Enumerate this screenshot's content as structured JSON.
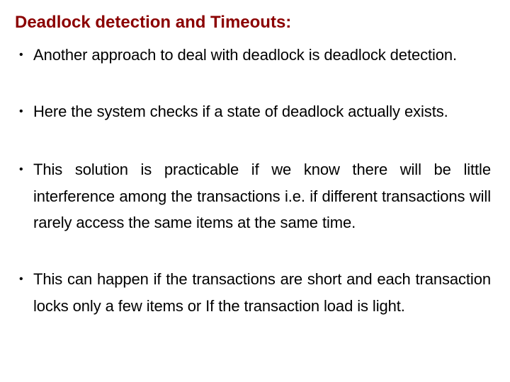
{
  "slide": {
    "title": "Deadlock detection and Timeouts:",
    "title_color": "#8b0000",
    "bullet_glyph": "•",
    "bullets": [
      {
        "text": "Another approach to deal with deadlock is deadlock detection."
      },
      {
        "text": "Here the system checks if a state of deadlock actually exists."
      },
      {
        "text": "This solution is practicable if we know there will be little interference among the transactions i.e. if different transactions will rarely access the same items at the same time."
      },
      {
        "text": "This can happen if the transactions are short and each transaction locks only a few items or If the transaction load is light."
      }
    ]
  }
}
